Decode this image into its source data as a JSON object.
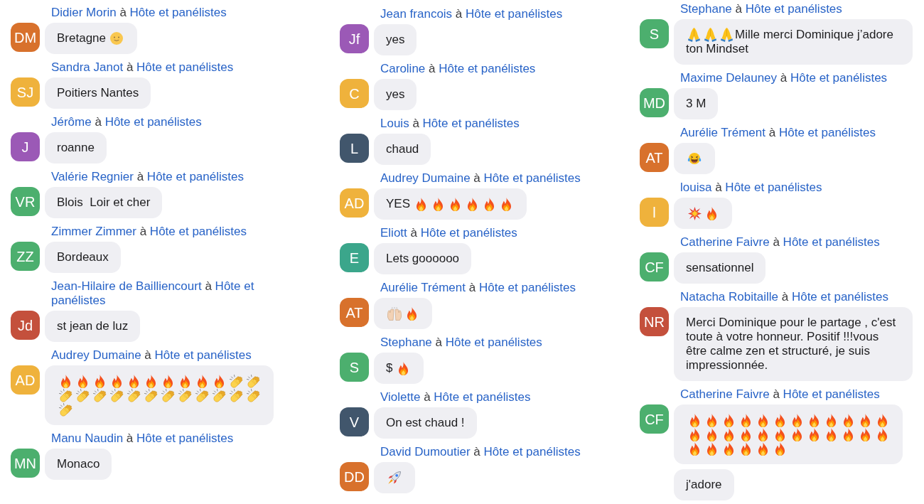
{
  "columns": [
    {
      "messages": [
        {
          "sender": "Didier Morin",
          "preposition": "à",
          "recipient": "Hôte et panélistes",
          "avatar": {
            "initials": "DM",
            "color": "#d8712c"
          },
          "content": [
            {
              "kind": "text",
              "text": "Bretagne"
            },
            {
              "kind": "smile"
            }
          ]
        },
        {
          "sender": "Sandra Janot",
          "preposition": "à",
          "recipient": "Hôte et panélistes",
          "avatar": {
            "initials": "SJ",
            "color": "#efb23c"
          },
          "content": [
            {
              "kind": "text",
              "text": "Poitiers Nantes"
            }
          ]
        },
        {
          "sender": "Jérôme",
          "preposition": "à",
          "recipient": "Hôte et panélistes",
          "avatar": {
            "initials": "J",
            "color": "#9b59b6"
          },
          "content": [
            {
              "kind": "text",
              "text": "roanne"
            }
          ]
        },
        {
          "sender": "Valérie Regnier",
          "preposition": "à",
          "recipient": "Hôte et panélistes",
          "avatar": {
            "initials": "VR",
            "color": "#4caf6e"
          },
          "content": [
            {
              "kind": "text",
              "text": "Blois  Loir et cher"
            }
          ]
        },
        {
          "sender": "Zimmer Zimmer",
          "preposition": "à",
          "recipient": "Hôte et panélistes",
          "avatar": {
            "initials": "ZZ",
            "color": "#4caf6e"
          },
          "content": [
            {
              "kind": "text",
              "text": "Bordeaux"
            }
          ]
        },
        {
          "sender": "Jean-Hilaire de Bailliencourt",
          "preposition": "à",
          "recipient": "Hôte et panélistes",
          "avatar": {
            "initials": "Jd",
            "color": "#c4503c"
          },
          "content": [
            {
              "kind": "text",
              "text": "st jean de luz"
            }
          ]
        },
        {
          "sender": "Audrey Dumaine",
          "preposition": "à",
          "recipient": "Hôte et panélistes",
          "avatar": {
            "initials": "AD",
            "color": "#efb23c"
          },
          "content": [
            {
              "kind": "fire"
            },
            {
              "kind": "fire"
            },
            {
              "kind": "fire"
            },
            {
              "kind": "fire"
            },
            {
              "kind": "fire"
            },
            {
              "kind": "fire"
            },
            {
              "kind": "fire"
            },
            {
              "kind": "fire"
            },
            {
              "kind": "fire"
            },
            {
              "kind": "fire"
            },
            {
              "kind": "clap"
            },
            {
              "kind": "clap"
            },
            {
              "kind": "clap"
            },
            {
              "kind": "clap"
            },
            {
              "kind": "clap"
            },
            {
              "kind": "clap"
            },
            {
              "kind": "clap"
            },
            {
              "kind": "clap"
            },
            {
              "kind": "clap"
            },
            {
              "kind": "clap"
            },
            {
              "kind": "clap"
            },
            {
              "kind": "clap"
            },
            {
              "kind": "clap"
            },
            {
              "kind": "clap"
            },
            {
              "kind": "clap"
            }
          ]
        },
        {
          "sender": "Manu Naudin",
          "preposition": "à",
          "recipient": "Hôte et panélistes",
          "avatar": {
            "initials": "MN",
            "color": "#4caf6e"
          },
          "content": [
            {
              "kind": "text",
              "text": "Monaco"
            }
          ]
        }
      ]
    },
    {
      "messages": [
        {
          "sender": "Jean francois",
          "preposition": "à",
          "recipient": "Hôte et panélistes",
          "avatar": {
            "initials": "Jf",
            "color": "#9b59b6"
          },
          "content": [
            {
              "kind": "text",
              "text": "yes"
            }
          ]
        },
        {
          "sender": "Caroline",
          "preposition": "à",
          "recipient": "Hôte et panélistes",
          "avatar": {
            "initials": "C",
            "color": "#efb23c"
          },
          "content": [
            {
              "kind": "text",
              "text": "yes"
            }
          ]
        },
        {
          "sender": "Louis",
          "preposition": "à",
          "recipient": "Hôte et panélistes",
          "avatar": {
            "initials": "L",
            "color": "#41566c"
          },
          "content": [
            {
              "kind": "text",
              "text": "chaud"
            }
          ]
        },
        {
          "sender": "Audrey Dumaine",
          "preposition": "à",
          "recipient": "Hôte et panélistes",
          "avatar": {
            "initials": "AD",
            "color": "#efb23c"
          },
          "content": [
            {
              "kind": "text",
              "text": "YES"
            },
            {
              "kind": "fire"
            },
            {
              "kind": "fire"
            },
            {
              "kind": "fire"
            },
            {
              "kind": "fire"
            },
            {
              "kind": "fire"
            },
            {
              "kind": "fire"
            }
          ]
        },
        {
          "sender": "Eliott",
          "preposition": "à",
          "recipient": "Hôte et panélistes",
          "avatar": {
            "initials": "E",
            "color": "#3ba68b"
          },
          "content": [
            {
              "kind": "text",
              "text": "Lets goooooo"
            }
          ]
        },
        {
          "sender": "Aurélie Trément",
          "preposition": "à",
          "recipient": "Hôte et panélistes",
          "avatar": {
            "initials": "AT",
            "color": "#d8712c"
          },
          "content": [
            {
              "kind": "raised_hands"
            },
            {
              "kind": "fire"
            }
          ]
        },
        {
          "sender": "Stephane",
          "preposition": "à",
          "recipient": "Hôte et panélistes",
          "avatar": {
            "initials": "S",
            "color": "#4caf6e"
          },
          "content": [
            {
              "kind": "text",
              "text": "$"
            },
            {
              "kind": "fire"
            }
          ]
        },
        {
          "sender": "Violette",
          "preposition": "à",
          "recipient": "Hôte et panélistes",
          "avatar": {
            "initials": "V",
            "color": "#41566c"
          },
          "content": [
            {
              "kind": "text",
              "text": "On est chaud !"
            }
          ]
        },
        {
          "sender": "David Dumoutier",
          "preposition": "à",
          "recipient": "Hôte et panélistes",
          "avatar": {
            "initials": "DD",
            "color": "#d8712c"
          },
          "content": [
            {
              "kind": "rocket"
            }
          ]
        }
      ]
    },
    {
      "messages": [
        {
          "sender": "Stephane",
          "preposition": "à",
          "recipient": "Hôte et panélistes",
          "avatar": {
            "initials": "S",
            "color": "#4caf6e"
          },
          "content": [
            {
              "kind": "pray"
            },
            {
              "kind": "pray"
            },
            {
              "kind": "pray"
            },
            {
              "kind": "text",
              "text": "Mille merci Dominique j’adore"
            },
            {
              "kind": "text",
              "text": "ton Mindset"
            }
          ]
        },
        {
          "sender": "Maxime Delauney",
          "preposition": "à",
          "recipient": "Hôte et panélistes",
          "avatar": {
            "initials": "MD",
            "color": "#4caf6e"
          },
          "content": [
            {
              "kind": "text",
              "text": "3 M"
            }
          ]
        },
        {
          "sender": "Aurélie Trément",
          "preposition": "à",
          "recipient": "Hôte et panélistes",
          "avatar": {
            "initials": "AT",
            "color": "#d8712c"
          },
          "content": [
            {
              "kind": "tears_of_joy"
            }
          ]
        },
        {
          "sender": "louisa",
          "preposition": "à",
          "recipient": "Hôte et panélistes",
          "avatar": {
            "initials": "l",
            "color": "#efb23c"
          },
          "content": [
            {
              "kind": "collision"
            },
            {
              "kind": "fire"
            }
          ]
        },
        {
          "sender": "Catherine Faivre",
          "preposition": "à",
          "recipient": "Hôte et panélistes",
          "avatar": {
            "initials": "CF",
            "color": "#4caf6e"
          },
          "content": [
            {
              "kind": "text",
              "text": "sensationnel"
            }
          ]
        },
        {
          "sender": "Natacha Robitaille",
          "preposition": "à",
          "recipient": "Hôte et panélistes",
          "avatar": {
            "initials": "NR",
            "color": "#c4503c"
          },
          "content": [
            {
              "kind": "text",
              "text": "Merci Dominique pour le partage , c'est toute à votre honneur. Positif !!!vous être calme zen et structuré, je suis impressionnée."
            }
          ]
        },
        {
          "sender": "Catherine Faivre",
          "preposition": "à",
          "recipient": "Hôte et panélistes",
          "avatar": {
            "initials": "CF",
            "color": "#4caf6e"
          },
          "content": [
            {
              "kind": "fire"
            },
            {
              "kind": "fire"
            },
            {
              "kind": "fire"
            },
            {
              "kind": "fire"
            },
            {
              "kind": "fire"
            },
            {
              "kind": "fire"
            },
            {
              "kind": "fire"
            },
            {
              "kind": "fire"
            },
            {
              "kind": "fire"
            },
            {
              "kind": "fire"
            },
            {
              "kind": "fire"
            },
            {
              "kind": "fire"
            },
            {
              "kind": "fire"
            },
            {
              "kind": "fire"
            },
            {
              "kind": "fire"
            },
            {
              "kind": "fire"
            },
            {
              "kind": "fire"
            },
            {
              "kind": "fire"
            },
            {
              "kind": "fire"
            },
            {
              "kind": "fire"
            },
            {
              "kind": "fire"
            },
            {
              "kind": "fire"
            },
            {
              "kind": "fire"
            },
            {
              "kind": "fire"
            },
            {
              "kind": "fire"
            },
            {
              "kind": "fire"
            },
            {
              "kind": "fire"
            },
            {
              "kind": "fire"
            },
            {
              "kind": "fire"
            },
            {
              "kind": "fire"
            }
          ]
        },
        {
          "content": [
            {
              "kind": "text",
              "text": "j'adore"
            }
          ]
        }
      ]
    }
  ]
}
